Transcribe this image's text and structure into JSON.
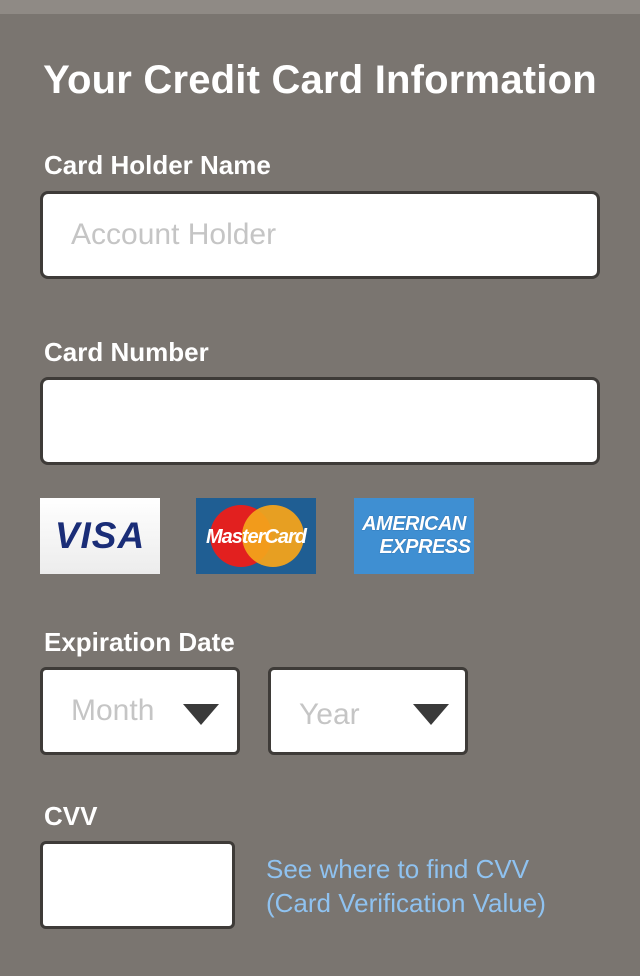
{
  "form": {
    "title": "Your Credit Card Information",
    "card_holder": {
      "label": "Card Holder Name",
      "placeholder": "Account Holder",
      "value": ""
    },
    "card_number": {
      "label": "Card Number",
      "placeholder": "",
      "value": ""
    },
    "card_logos": {
      "visa": "VISA",
      "mastercard": "MasterCard",
      "amex_line1": "AMERICAN",
      "amex_line2": "EXPRESS"
    },
    "expiration": {
      "label": "Expiration Date",
      "month_placeholder": "Month",
      "year_placeholder": "Year"
    },
    "cvv": {
      "label": "CVV",
      "value": "",
      "help_line1": "See where to find CVV",
      "help_line2": "(Card Verification Value)"
    }
  },
  "colors": {
    "background": "#7a7570",
    "link": "#8fc2f0",
    "visa": "#1a2d77",
    "mastercard_red": "#e2201f",
    "mastercard_orange": "#f2a21b",
    "amex_blue": "#3f8fd2"
  }
}
